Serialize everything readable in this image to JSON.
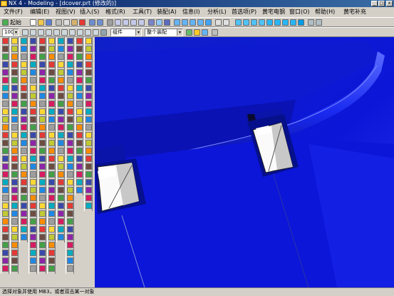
{
  "window": {
    "title": "NX 4 - Modeling - [dcover.prt (修改的)]",
    "controls": {
      "minimize": "_",
      "maximize": "□",
      "close": "x"
    }
  },
  "menu": {
    "items": [
      "文件(F)",
      "编辑(E)",
      "视图(V)",
      "插入(S)",
      "格式(R)",
      "工具(T)",
      "装配(A)",
      "信息(I)",
      "分析(L)",
      "首选项(P)",
      "黄宅电钢",
      "窗口(O)",
      "帮助(H)",
      "黄宅补充"
    ]
  },
  "toolbar1": {
    "start_label": "起始"
  },
  "toolbar2": {
    "zoom_value": "100",
    "filter_value": "组件",
    "assembly_value": "整个装配",
    "dropdown_arrow": "▾"
  },
  "status": {
    "prompt": "选择对象并使用 MB3，或者双击某一对象"
  },
  "colors": {
    "viewport_blue": "#0c16d8",
    "title_blue": "#0a246a",
    "chrome_gray": "#d4d0c8"
  }
}
